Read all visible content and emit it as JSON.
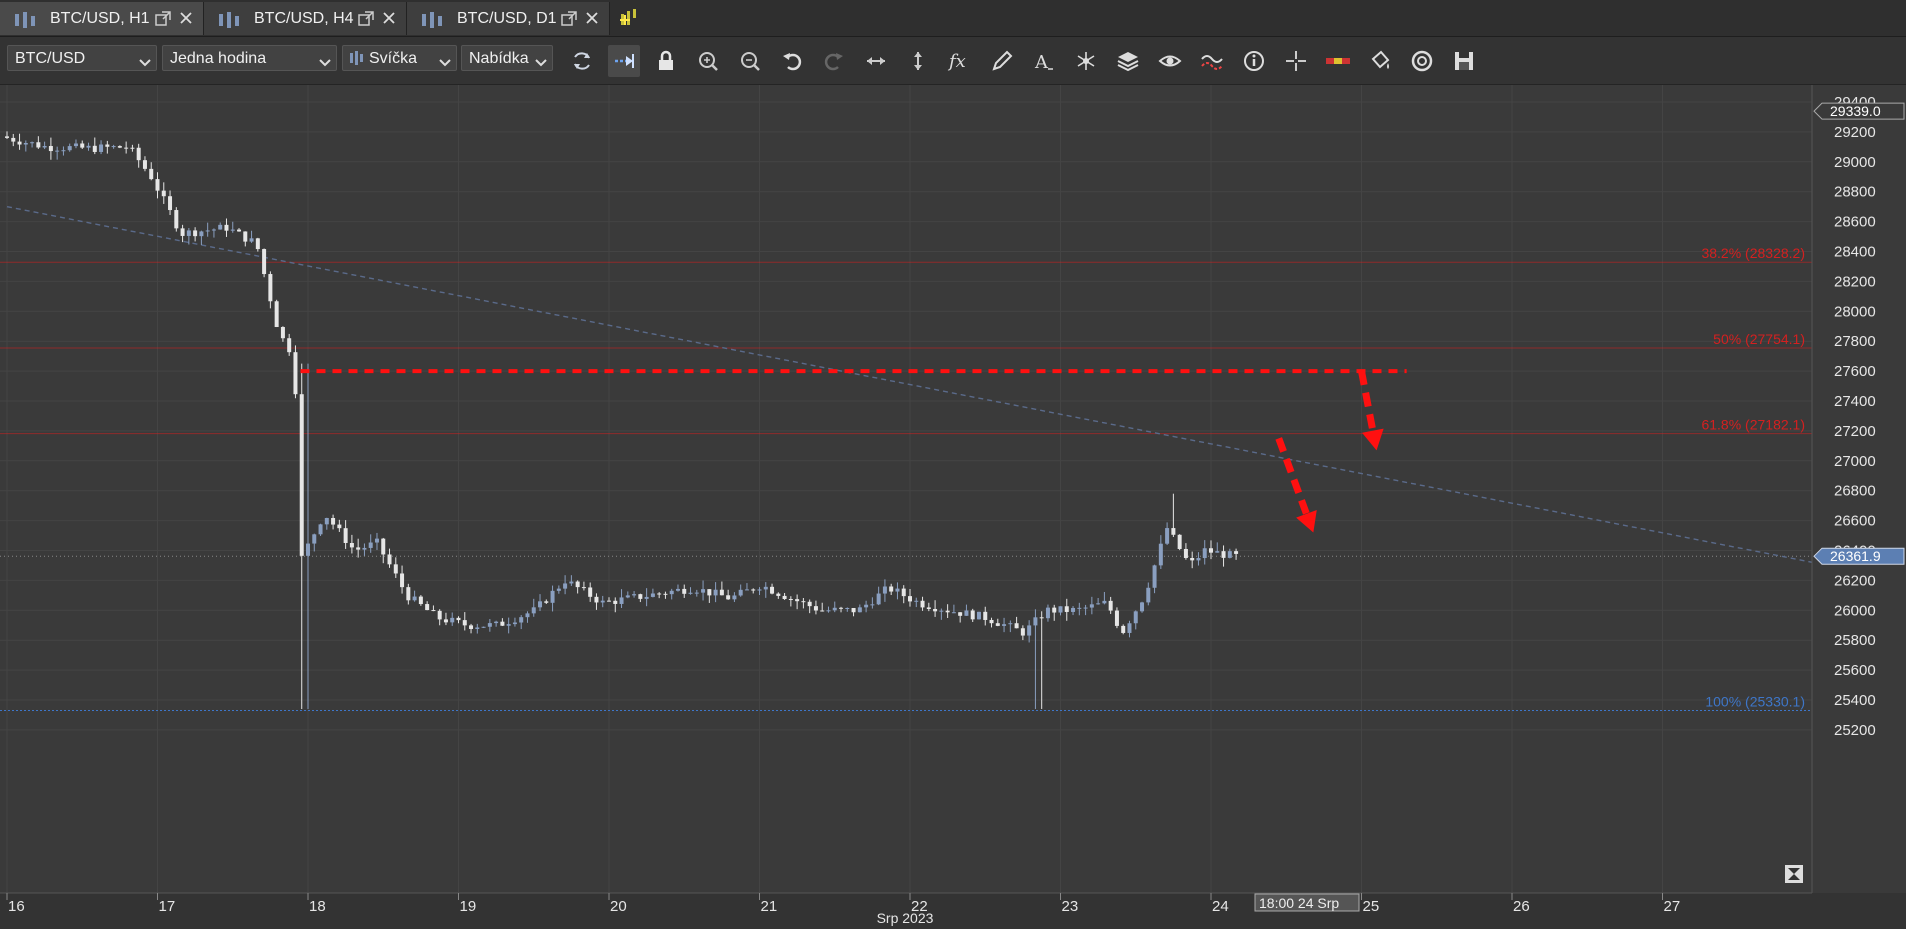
{
  "tabs": [
    {
      "label": "BTC/USD, H1",
      "active": true
    },
    {
      "label": "BTC/USD, H4",
      "active": false
    },
    {
      "label": "BTC/USD, D1",
      "active": false
    }
  ],
  "toolbar": {
    "instrument": "BTC/USD",
    "period": "Jedna hodina",
    "chart_type": "Svíčka",
    "price_side": "Nabídka"
  },
  "colors": {
    "candle_up": "#8a9fc0",
    "candle_down": "#e6e6e6",
    "fib_red": "#d42020",
    "fib_blue": "#3e76c8",
    "annotation_red": "#ff1010",
    "trend_line": "#5a6a8a"
  },
  "chart_data": {
    "type": "candlestick",
    "price_axis": {
      "ticks": [
        "29400",
        "29200",
        "29000",
        "28800",
        "28600",
        "28400",
        "28200",
        "28000",
        "27800",
        "27600",
        "27400",
        "27200",
        "27000",
        "26800",
        "26600",
        "26400",
        "26200",
        "26000",
        "25800",
        "25600",
        "25400",
        "25200"
      ],
      "current_price": "29339.0",
      "last_price": "26361.9"
    },
    "time_axis": {
      "ticks": [
        "16",
        "17",
        "18",
        "19",
        "20",
        "21",
        "22",
        "23",
        "24",
        "25",
        "26",
        "27"
      ],
      "month_label": "Srp 2023",
      "crosshair_label": "18:00 24 Srp"
    },
    "fib_levels": [
      {
        "label": "38.2% (28328.2)",
        "value": 28328.2
      },
      {
        "label": "50% (27754.1)",
        "value": 27754.1
      },
      {
        "label": "61.8% (27182.1)",
        "value": 27182.1
      },
      {
        "label": "100% (25330.1)",
        "value": 25330.1
      }
    ],
    "resistance_level": 27600,
    "trend_line": {
      "from_day": 16.0,
      "from_price": 28700,
      "to_day": 28.1,
      "to_price": 26300
    },
    "arrows": [
      {
        "from_day": 25.0,
        "from_price": 27600,
        "to_day": 25.1,
        "to_price": 27070
      },
      {
        "from_day": 24.45,
        "from_price": 27150,
        "to_day": 24.68,
        "to_price": 26520
      }
    ],
    "series_outline": [
      [
        16.0,
        29170
      ],
      [
        16.3,
        29100
      ],
      [
        16.6,
        29090
      ],
      [
        16.85,
        29100
      ],
      [
        17.0,
        28900
      ],
      [
        17.2,
        28520
      ],
      [
        17.5,
        28560
      ],
      [
        17.7,
        28450
      ],
      [
        17.85,
        27850
      ],
      [
        17.95,
        27700
      ],
      [
        18.0,
        26350
      ],
      [
        18.15,
        26650
      ],
      [
        18.35,
        26400
      ],
      [
        18.5,
        26450
      ],
      [
        18.7,
        26100
      ],
      [
        18.9,
        25950
      ],
      [
        19.1,
        25900
      ],
      [
        19.3,
        25900
      ],
      [
        19.55,
        26000
      ],
      [
        19.75,
        26200
      ],
      [
        20.0,
        26050
      ],
      [
        20.3,
        26100
      ],
      [
        20.6,
        26150
      ],
      [
        20.85,
        26080
      ],
      [
        21.05,
        26170
      ],
      [
        21.25,
        26080
      ],
      [
        21.45,
        26000
      ],
      [
        21.7,
        26000
      ],
      [
        21.9,
        26150
      ],
      [
        22.1,
        26050
      ],
      [
        22.3,
        26000
      ],
      [
        22.55,
        25950
      ],
      [
        22.8,
        25850
      ],
      [
        22.95,
        26000
      ],
      [
        23.15,
        26000
      ],
      [
        23.35,
        26050
      ],
      [
        23.45,
        25850
      ],
      [
        23.6,
        26100
      ],
      [
        23.75,
        26550
      ],
      [
        23.9,
        26300
      ],
      [
        24.0,
        26400
      ],
      [
        24.2,
        26360
      ]
    ]
  }
}
